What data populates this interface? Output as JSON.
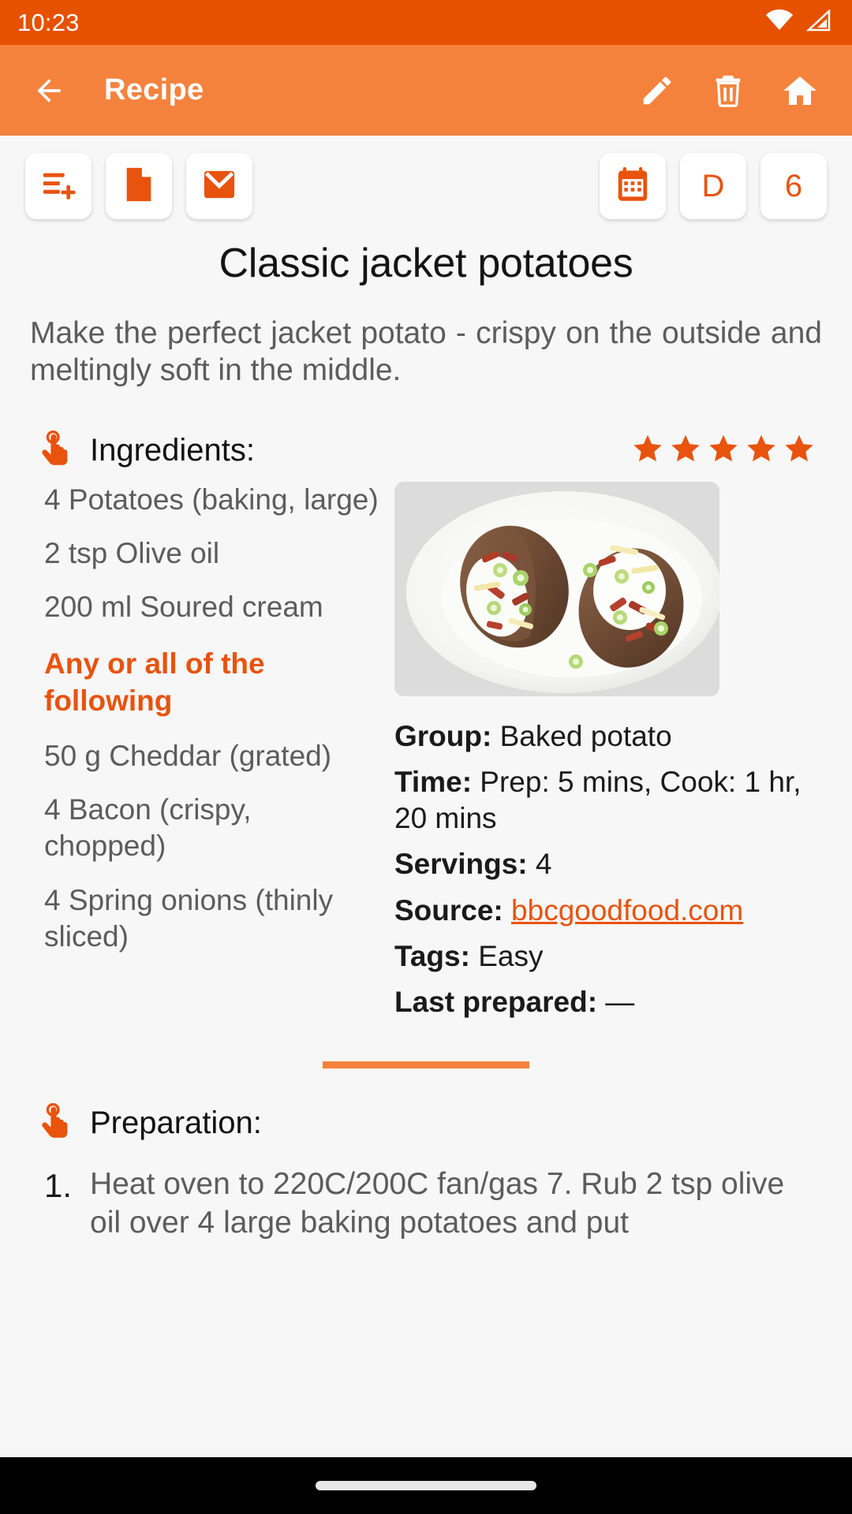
{
  "status_bar": {
    "time": "10:23",
    "icons": [
      "wifi-icon",
      "cellular-signal-icon"
    ]
  },
  "app_bar": {
    "back_icon": "arrow-left-icon",
    "title": "Recipe",
    "actions": [
      {
        "name": "edit-button",
        "icon": "pencil-icon"
      },
      {
        "name": "delete-button",
        "icon": "trash-icon"
      },
      {
        "name": "home-button",
        "icon": "home-icon"
      }
    ]
  },
  "quick_actions": {
    "left": [
      {
        "name": "add-to-shopping-list-button",
        "icon": "list-add-icon",
        "label": ""
      },
      {
        "name": "export-document-button",
        "icon": "document-icon",
        "label": ""
      },
      {
        "name": "email-recipe-button",
        "icon": "envelope-icon",
        "label": ""
      }
    ],
    "right": [
      {
        "name": "calendar-button",
        "icon": "calendar-icon",
        "label": ""
      },
      {
        "name": "difficulty-button",
        "icon": "letter-badge",
        "label": "D"
      },
      {
        "name": "rating-count-button",
        "icon": "number-badge",
        "label": "6"
      }
    ]
  },
  "recipe": {
    "title": "Classic jacket potatoes",
    "description": "Make the perfect jacket potato - crispy on the outside and meltingly soft in the middle.",
    "ingredients_heading": "Ingredients:",
    "rating": 5,
    "rating_max": 5,
    "ingredients": [
      "4 Potatoes (baking, large)",
      "2 tsp Olive oil",
      "200 ml Soured cream"
    ],
    "ingredients_subheading": "Any or all of the following",
    "ingredients_optional": [
      "50 g Cheddar (grated)",
      "4 Bacon (crispy, chopped)",
      "4 Spring onions (thinly sliced)"
    ],
    "image_alt": "two baked jacket potatoes topped with soured cream, cheese, bacon and spring onions on a white plate",
    "meta": [
      {
        "label": "Group:",
        "value": "Baked potato",
        "link": false
      },
      {
        "label": "Time:",
        "value": "Prep: 5 mins, Cook: 1 hr, 20 mins",
        "link": false
      },
      {
        "label": "Servings:",
        "value": "4",
        "link": false
      },
      {
        "label": "Source:",
        "value": "bbcgoodfood.com",
        "link": true
      },
      {
        "label": "Tags:",
        "value": "Easy",
        "link": false
      },
      {
        "label": "Last prepared:",
        "value": "—",
        "link": false
      }
    ],
    "preparation_heading": "Preparation:",
    "preparation_steps": [
      {
        "number": "1.",
        "text": "Heat oven to 220C/200C fan/gas 7. Rub 2 tsp olive oil over 4 large baking potatoes and put"
      }
    ]
  },
  "colors": {
    "status_bar": "#e65100",
    "app_bar": "#f5823c",
    "accent": "#e8530e",
    "divider": "#f5823c",
    "page_bg": "#f7f7f7",
    "body_text": "#5c5c5c",
    "heading_text": "#141414"
  },
  "nav_bar": {
    "gesture_pill": "home-gesture-pill"
  }
}
